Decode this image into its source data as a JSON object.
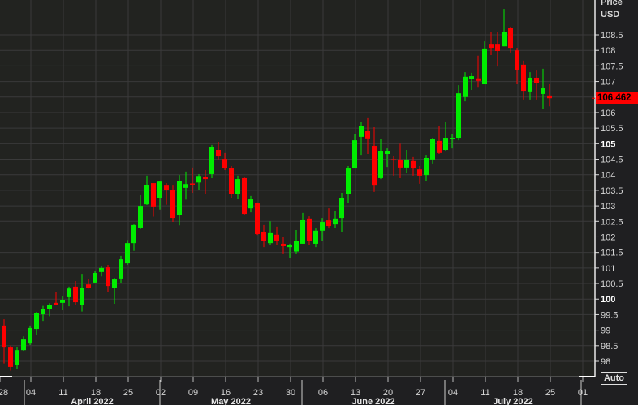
{
  "axis": {
    "title_line1": "Price",
    "title_line2": "USD",
    "auto_label": "Auto",
    "last_price": "106.462"
  },
  "colors": {
    "up": "#00ee00",
    "down": "#ff0000",
    "background": "#222320",
    "grid": "#3a3a3a",
    "last_price_tag": "#ff0000"
  },
  "chart_data": {
    "type": "candlestick",
    "ylabel": "Price USD",
    "ylim": [
      97.6,
      109.4
    ],
    "grid": true,
    "y_ticks": [
      "98",
      "98.5",
      "99",
      "99.5",
      "100",
      "100.5",
      "101",
      "101.5",
      "102",
      "102.5",
      "103",
      "103.5",
      "104",
      "104.5",
      "105",
      "105.5",
      "106",
      "106.5",
      "107",
      "107.5",
      "108",
      "108.5"
    ],
    "y_ticks_bold": [
      "100",
      "105"
    ],
    "x_ticks": [
      "28",
      "04",
      "11",
      "18",
      "25",
      "02",
      "09",
      "16",
      "23",
      "30",
      "06",
      "13",
      "20",
      "27",
      "04",
      "11",
      "18",
      "25",
      "01"
    ],
    "months": [
      "April 2022",
      "May 2022",
      "June 2022",
      "July 2022"
    ],
    "last_value": 106.462,
    "ohlc": [
      [
        99.15,
        99.35,
        97.93,
        98.44
      ],
      [
        98.44,
        98.5,
        97.7,
        97.82
      ],
      [
        97.87,
        98.47,
        97.74,
        98.36
      ],
      [
        98.36,
        98.8,
        98.34,
        98.7
      ],
      [
        98.57,
        99.15,
        98.52,
        99.07
      ],
      [
        99.04,
        99.59,
        98.86,
        99.54
      ],
      [
        99.51,
        99.78,
        99.3,
        99.67
      ],
      [
        99.69,
        99.87,
        99.45,
        99.8
      ],
      [
        99.88,
        100.24,
        99.8,
        99.82
      ],
      [
        99.88,
        100.1,
        99.64,
        99.98
      ],
      [
        100.06,
        100.4,
        99.77,
        100.34
      ],
      [
        100.4,
        100.58,
        99.82,
        99.9
      ],
      [
        99.82,
        100.81,
        99.6,
        100.37
      ],
      [
        100.47,
        100.63,
        100.34,
        100.37
      ],
      [
        100.53,
        100.9,
        100.5,
        100.84
      ],
      [
        100.87,
        101.07,
        100.73,
        101.0
      ],
      [
        101.02,
        101.1,
        100.24,
        100.42
      ],
      [
        100.37,
        100.68,
        99.85,
        100.63
      ],
      [
        100.66,
        101.39,
        100.5,
        101.28
      ],
      [
        101.15,
        101.9,
        101.1,
        101.8
      ],
      [
        101.8,
        102.4,
        101.55,
        102.38
      ],
      [
        102.3,
        103.34,
        102.25,
        103.0
      ],
      [
        103.05,
        103.97,
        103.03,
        103.68
      ],
      [
        103.73,
        103.73,
        102.65,
        102.98
      ],
      [
        103.24,
        103.78,
        102.88,
        103.78
      ],
      [
        103.65,
        103.73,
        103.04,
        103.5
      ],
      [
        103.52,
        103.65,
        102.48,
        102.61
      ],
      [
        102.69,
        103.99,
        102.37,
        103.81
      ],
      [
        103.58,
        104.1,
        103.2,
        103.7
      ],
      [
        103.72,
        104.23,
        103.42,
        103.7
      ],
      [
        103.75,
        104.02,
        103.5,
        103.96
      ],
      [
        103.94,
        104.15,
        103.39,
        103.86
      ],
      [
        104.02,
        104.96,
        103.89,
        104.9
      ],
      [
        104.8,
        105.06,
        104.49,
        104.59
      ],
      [
        104.51,
        104.7,
        104.15,
        104.2
      ],
      [
        104.2,
        104.28,
        103.24,
        103.39
      ],
      [
        103.37,
        103.97,
        103.21,
        103.86
      ],
      [
        103.89,
        103.94,
        102.69,
        102.74
      ],
      [
        102.92,
        103.32,
        102.79,
        103.21
      ],
      [
        103.08,
        103.11,
        102.06,
        102.09
      ],
      [
        102.17,
        102.38,
        101.67,
        101.88
      ],
      [
        101.8,
        102.5,
        101.75,
        102.12
      ],
      [
        102.07,
        102.33,
        101.73,
        101.86
      ],
      [
        101.78,
        101.99,
        101.47,
        101.7
      ],
      [
        101.67,
        101.78,
        101.33,
        101.73
      ],
      [
        101.53,
        102.22,
        101.47,
        101.87
      ],
      [
        101.78,
        102.77,
        101.78,
        102.56
      ],
      [
        102.59,
        102.66,
        101.75,
        101.86
      ],
      [
        101.78,
        102.27,
        101.67,
        102.2
      ],
      [
        102.2,
        102.61,
        101.88,
        102.48
      ],
      [
        102.53,
        102.92,
        102.27,
        102.35
      ],
      [
        102.4,
        102.82,
        102.3,
        102.59
      ],
      [
        102.61,
        103.42,
        102.17,
        103.26
      ],
      [
        103.39,
        104.28,
        103.08,
        104.2
      ],
      [
        104.2,
        105.32,
        104.2,
        105.11
      ],
      [
        105.22,
        105.69,
        104.64,
        105.56
      ],
      [
        105.4,
        105.82,
        104.67,
        105.17
      ],
      [
        104.93,
        105.53,
        103.45,
        103.65
      ],
      [
        103.89,
        105.14,
        103.86,
        104.75
      ],
      [
        104.67,
        104.85,
        104.25,
        104.75
      ],
      [
        104.5,
        104.6,
        103.97,
        104.48
      ],
      [
        104.49,
        105.0,
        103.89,
        104.23
      ],
      [
        104.23,
        104.8,
        104.07,
        104.49
      ],
      [
        104.44,
        104.57,
        103.97,
        104.2
      ],
      [
        104.17,
        104.28,
        103.71,
        103.97
      ],
      [
        103.99,
        104.64,
        103.81,
        104.54
      ],
      [
        104.49,
        105.19,
        104.36,
        105.14
      ],
      [
        105.09,
        105.58,
        104.67,
        104.7
      ],
      [
        104.8,
        105.69,
        104.75,
        105.19
      ],
      [
        105.14,
        105.3,
        104.85,
        105.19
      ],
      [
        105.19,
        106.88,
        105.11,
        106.62
      ],
      [
        106.5,
        107.3,
        106.36,
        107.15
      ],
      [
        107.07,
        107.28,
        106.73,
        107.17
      ],
      [
        107.1,
        107.83,
        106.8,
        107.02
      ],
      [
        106.91,
        108.29,
        106.91,
        108.06
      ],
      [
        108.21,
        108.6,
        107.85,
        108.08
      ],
      [
        108.21,
        108.6,
        107.48,
        107.98
      ],
      [
        108.13,
        109.33,
        108.13,
        108.58
      ],
      [
        108.71,
        108.76,
        107.93,
        108.08
      ],
      [
        108.0,
        108.08,
        106.91,
        107.38
      ],
      [
        107.54,
        107.67,
        106.42,
        106.7
      ],
      [
        106.68,
        107.3,
        106.42,
        107.12
      ],
      [
        107.12,
        107.35,
        106.42,
        106.94
      ],
      [
        106.6,
        107.41,
        106.13,
        106.78
      ],
      [
        106.55,
        106.91,
        106.2,
        106.462
      ]
    ]
  }
}
